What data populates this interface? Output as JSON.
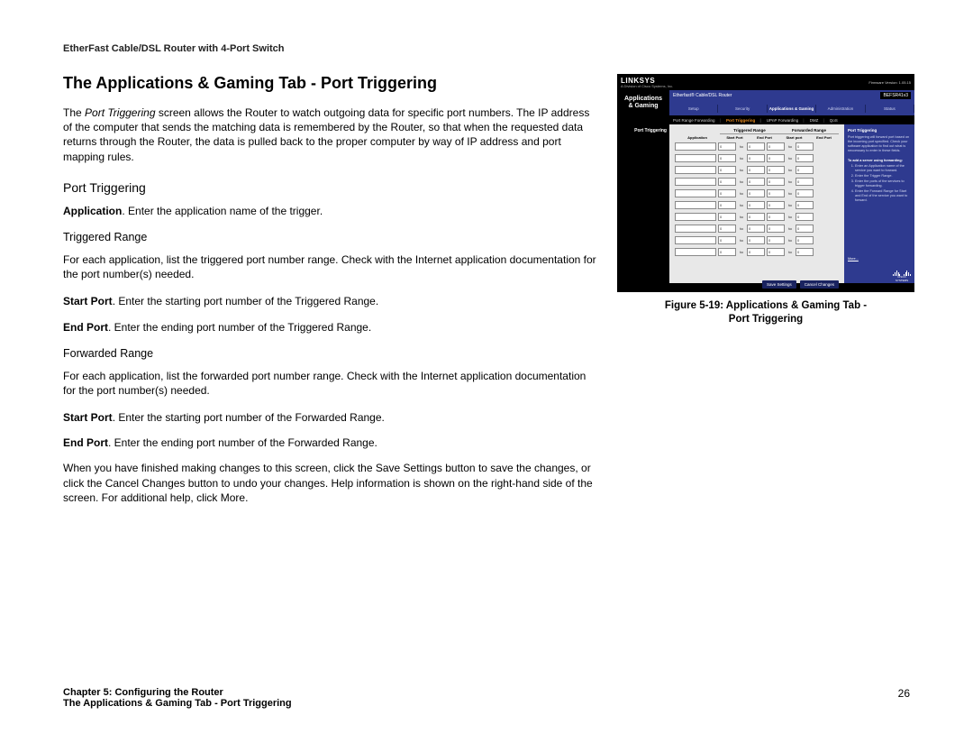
{
  "header": "EtherFast Cable/DSL Router with 4-Port Switch",
  "title": "The Applications & Gaming Tab - Port Triggering",
  "intro": {
    "pre": "The ",
    "ital": "Port Triggering",
    "post": " screen allows the Router to watch outgoing data for specific port numbers. The IP address of the computer that sends the matching data is remembered by the Router, so that when the requested data returns through the Router, the data is pulled back to the proper computer by way of IP address and port mapping rules."
  },
  "sub_port_triggering": "Port Triggering",
  "app_line": {
    "b": "Application",
    "rest": ". Enter the application name of the trigger."
  },
  "triggered_range_h": "Triggered Range",
  "triggered_range_p": "For each application, list the triggered port number range. Check with the Internet application documentation for the port number(s) needed.",
  "tr_start": {
    "b": "Start Port",
    "rest": ". Enter the starting port number of the Triggered Range."
  },
  "tr_end": {
    "b": "End Port",
    "rest": ". Enter the ending port number of the Triggered Range."
  },
  "forwarded_range_h": "Forwarded Range",
  "forwarded_range_p": "For each application, list the forwarded port number range. Check with the Internet application documentation for the port number(s) needed.",
  "fw_start": {
    "b": "Start Port",
    "rest": ". Enter the starting port number of the Forwarded Range."
  },
  "fw_end": {
    "b": "End Port",
    "rest": ". Enter the ending port number of the Forwarded Range."
  },
  "closing": {
    "p1": "When you have finished making changes to this screen, click the ",
    "b1": "Save Settings",
    "p2": " button to save the changes, or click the ",
    "b2": "Cancel Changes",
    "p3": " button to undo your changes. Help information is shown on the right-hand side of the screen. For additional help, click ",
    "b3": "More",
    "p4": "."
  },
  "shot": {
    "brand": "LINKSYS",
    "subbrand": "A Division of Cisco Systems, Inc.",
    "fw": "Firmware Version: 1.05.15",
    "side_label_1": "Applications",
    "side_label_2": "& Gaming",
    "product": "Etherfast® Cable/DSL Router",
    "model": "BEFSR41v3",
    "tabs": [
      "Setup",
      "Security",
      "Applications & Gaming",
      "Administration",
      "Status"
    ],
    "subtabs": [
      "Port Range Forwarding",
      "Port Triggering",
      "UPnP Forwarding",
      "DMZ",
      "QoS"
    ],
    "left_label": "Port Triggering",
    "grp1": "Triggered Range",
    "grp2": "Forwarded Range",
    "col_app": "Application",
    "col_sp": "Start Port",
    "col_ep": "End Port",
    "col_sp2": "Start port",
    "col_ep2": "End Port",
    "port_default": "0",
    "to": "to",
    "help_title": "Port Triggering",
    "help_body": "Port triggering will forward port based on the incoming port specified. Check your software application to find out what is neccessary to enter in these fields.",
    "help_h2": "To add a server using forwarding:",
    "help_steps": [
      "Enter an Application name of the service you want to forward.",
      "Enter the Trigger Range.",
      "Enter the ports of the services to trigger forwarding.",
      "Enter the Forward Range for Start and End of the service you want to forward."
    ],
    "more": "More...",
    "btn_save": "Save Settings",
    "btn_cancel": "Cancel Changes",
    "cisco": "CISCO SYSTEMS"
  },
  "caption_l1": "Figure 5-19: Applications & Gaming Tab -",
  "caption_l2": "Port Triggering",
  "footer": {
    "chapter": "Chapter 5: Configuring the Router",
    "section": "The Applications & Gaming Tab - Port Triggering",
    "page": "26"
  }
}
